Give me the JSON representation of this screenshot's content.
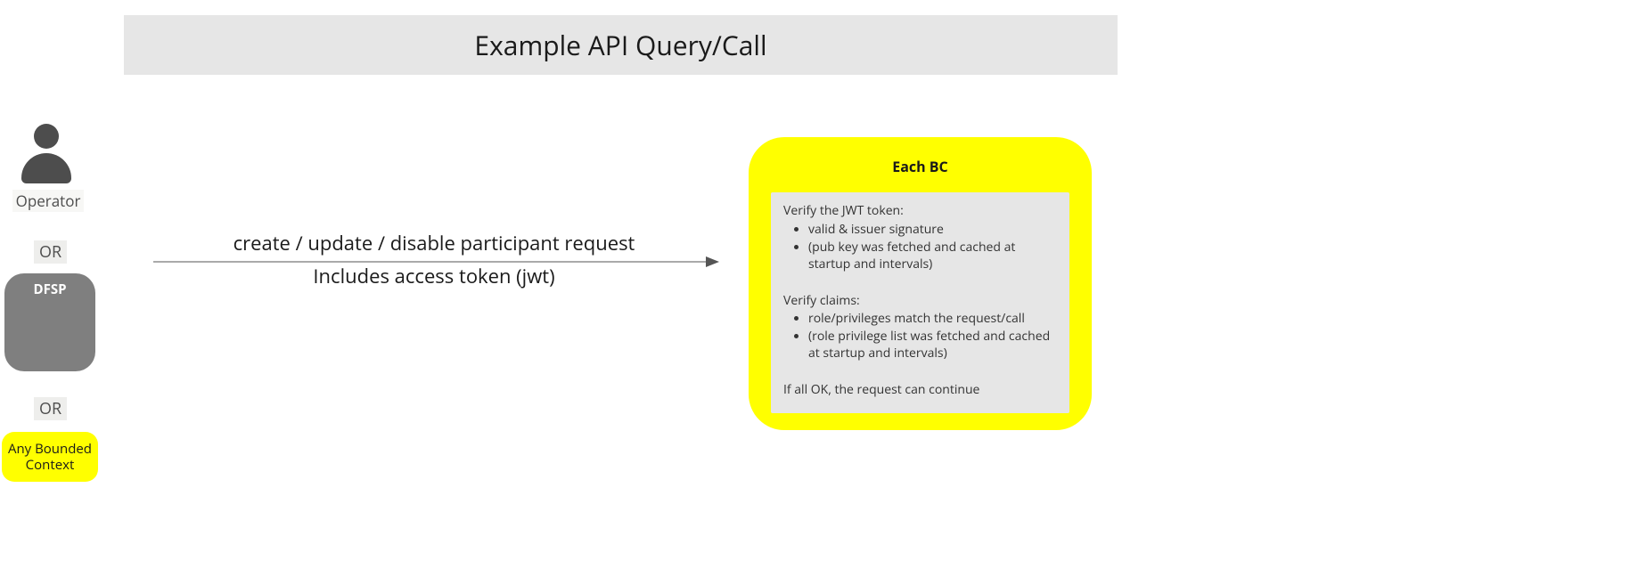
{
  "title": "Example API Query/Call",
  "left_column": {
    "operator_label": "Operator",
    "or1": "OR",
    "dfsp": "DFSP",
    "or2": "OR",
    "any_bc": "Any Bounded Context"
  },
  "arrow": {
    "line1": "create / update / disable participant request",
    "line2": "Includes access token (jwt)"
  },
  "bc_box": {
    "title": "Each BC",
    "verify_token_heading": "Verify the JWT token:",
    "verify_token_items": [
      "valid & issuer signature",
      "(pub key was fetched and cached at startup and intervals)"
    ],
    "verify_claims_heading": "Verify claims:",
    "verify_claims_items": [
      "role/privileges match the request/call",
      "(role privilege list was fetched and cached at startup and intervals)"
    ],
    "footer": "If all OK, the request can continue"
  }
}
